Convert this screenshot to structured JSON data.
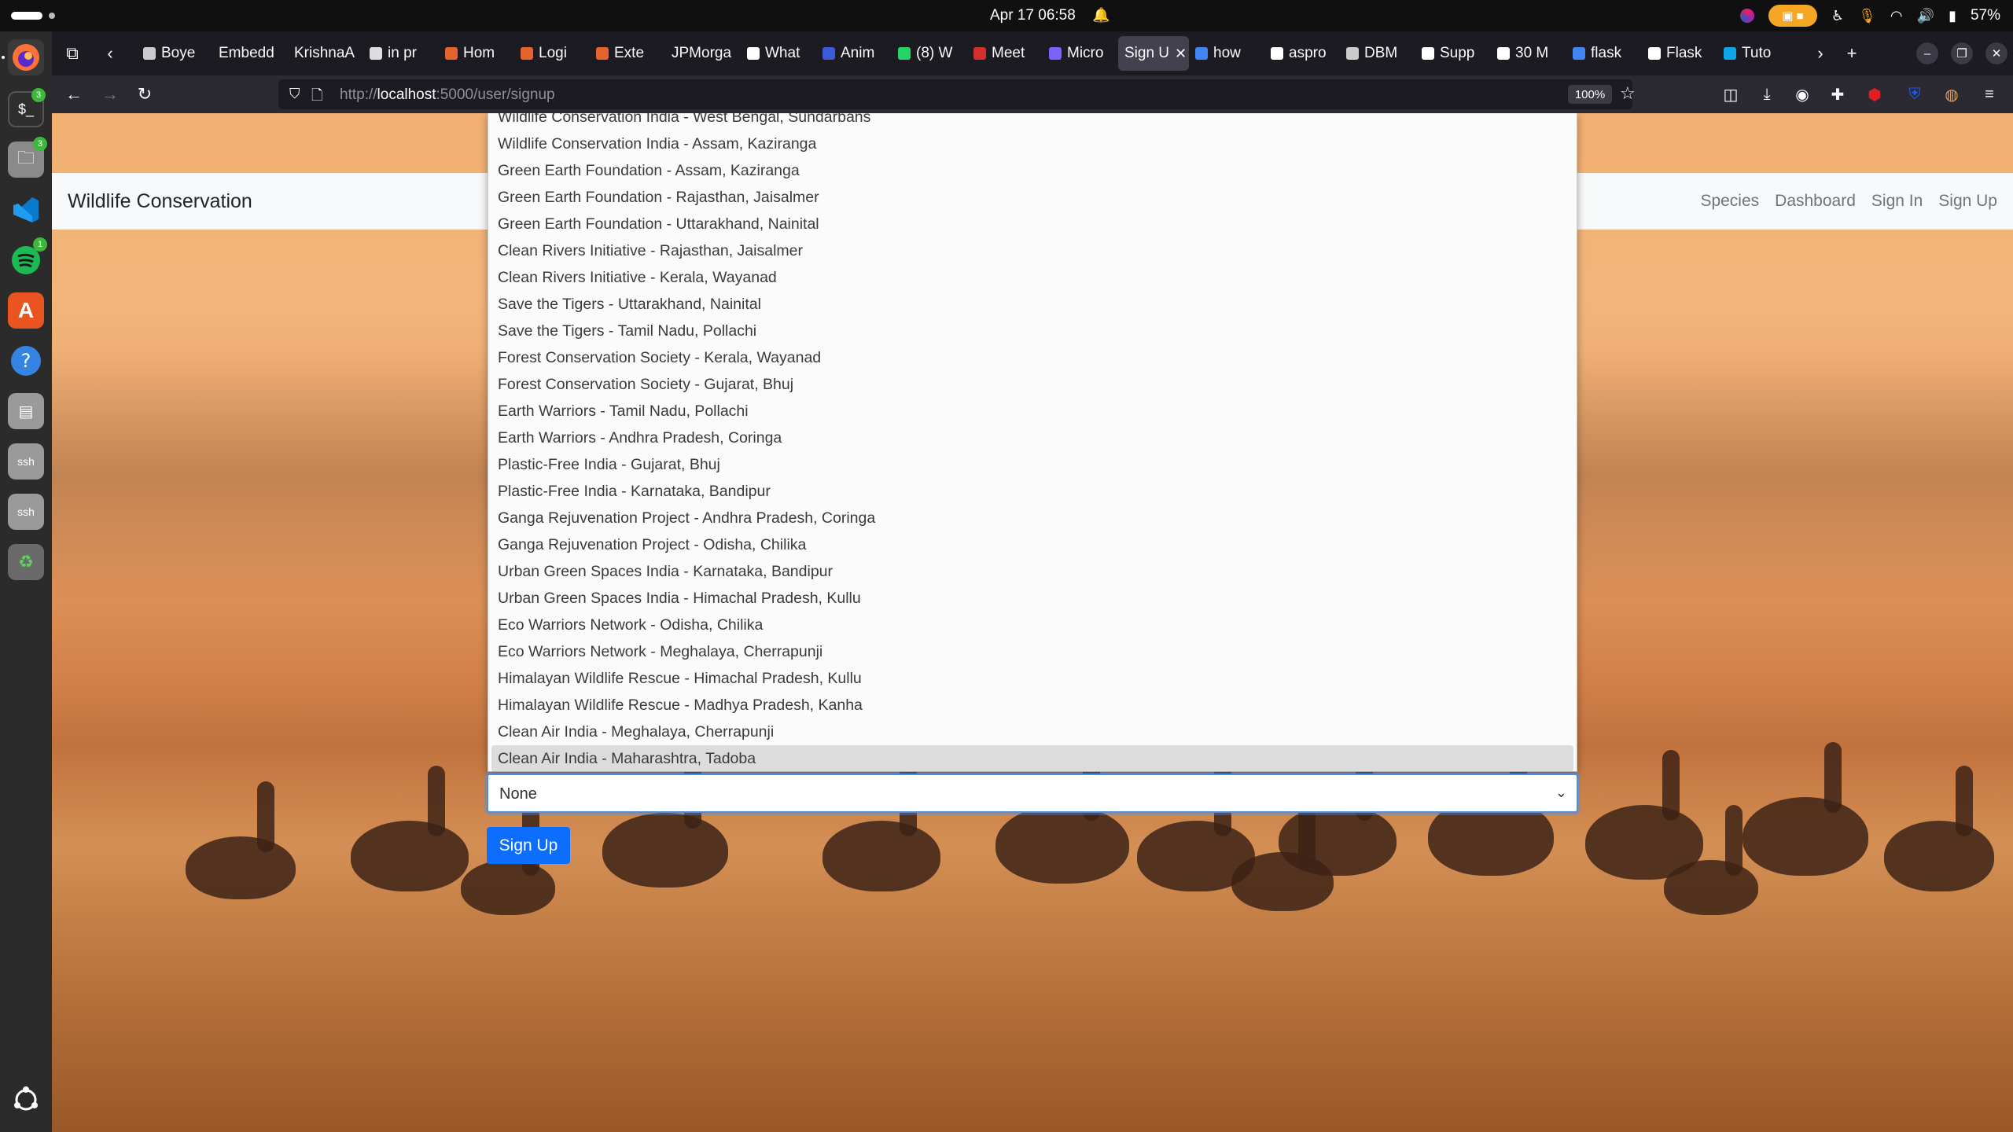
{
  "system": {
    "clock": "Apr 17  06:58",
    "battery": "57%"
  },
  "tabs": [
    {
      "label": "Boye",
      "color": "#cccccc"
    },
    {
      "label": "Embedd",
      "color": ""
    },
    {
      "label": "KrishnaA",
      "color": ""
    },
    {
      "label": "in pr",
      "color": "#dddddd"
    },
    {
      "label": "Hom",
      "color": "#e8622c"
    },
    {
      "label": "Logi",
      "color": "#e8622c"
    },
    {
      "label": "Exte",
      "color": "#e8622c"
    },
    {
      "label": "JPMorga",
      "color": ""
    },
    {
      "label": "What",
      "color": "#ffffff"
    },
    {
      "label": "Anim",
      "color": "#3b5bdb"
    },
    {
      "label": "(8) W",
      "color": "#25d366"
    },
    {
      "label": "Meet",
      "color": "#d32f2f"
    },
    {
      "label": "Micro",
      "color": "#7b61ff"
    },
    {
      "label": "Sign U",
      "color": "",
      "active": true
    },
    {
      "label": "how",
      "color": "#4285f4"
    },
    {
      "label": "aspro",
      "color": "#ffffff"
    },
    {
      "label": "DBM",
      "color": "#cccccc"
    },
    {
      "label": "Supp",
      "color": "#ffffff"
    },
    {
      "label": "30 M",
      "color": "#ffffff"
    },
    {
      "label": "flask",
      "color": "#4285f4"
    },
    {
      "label": "Flask",
      "color": "#ffffff"
    },
    {
      "label": "Tuto",
      "color": "#0ea5e9"
    }
  ],
  "browser": {
    "url_prefix": "http://",
    "url_host": "localhost",
    "url_path": ":5000/user/signup",
    "zoom": "100%"
  },
  "site": {
    "brand": "Wildlife Conservation",
    "nav": [
      "Species",
      "Dashboard",
      "Sign In",
      "Sign Up"
    ]
  },
  "dropdown": {
    "options": [
      "Wildlife Conservation India - West Bengal, Sundarbans",
      "Wildlife Conservation India - Assam, Kaziranga",
      "Green Earth Foundation - Assam, Kaziranga",
      "Green Earth Foundation - Rajasthan, Jaisalmer",
      "Green Earth Foundation - Uttarakhand, Nainital",
      "Clean Rivers Initiative - Rajasthan, Jaisalmer",
      "Clean Rivers Initiative - Kerala, Wayanad",
      "Save the Tigers - Uttarakhand, Nainital",
      "Save the Tigers - Tamil Nadu, Pollachi",
      "Forest Conservation Society - Kerala, Wayanad",
      "Forest Conservation Society - Gujarat, Bhuj",
      "Earth Warriors - Tamil Nadu, Pollachi",
      "Earth Warriors - Andhra Pradesh, Coringa",
      "Plastic-Free India - Gujarat, Bhuj",
      "Plastic-Free India - Karnataka, Bandipur",
      "Ganga Rejuvenation Project - Andhra Pradesh, Coringa",
      "Ganga Rejuvenation Project - Odisha, Chilika",
      "Urban Green Spaces India - Karnataka, Bandipur",
      "Urban Green Spaces India - Himachal Pradesh, Kullu",
      "Eco Warriors Network - Odisha, Chilika",
      "Eco Warriors Network - Meghalaya, Cherrapunji",
      "Himalayan Wildlife Rescue - Himachal Pradesh, Kullu",
      "Himalayan Wildlife Rescue - Madhya Pradesh, Kanha",
      "Clean Air India - Meghalaya, Cherrapunji",
      "Clean Air India - Maharashtra, Tadoba"
    ],
    "highlighted": "Clean Air India - Maharashtra, Tadoba"
  },
  "form": {
    "select_value": "None",
    "submit_label": "Sign Up"
  }
}
